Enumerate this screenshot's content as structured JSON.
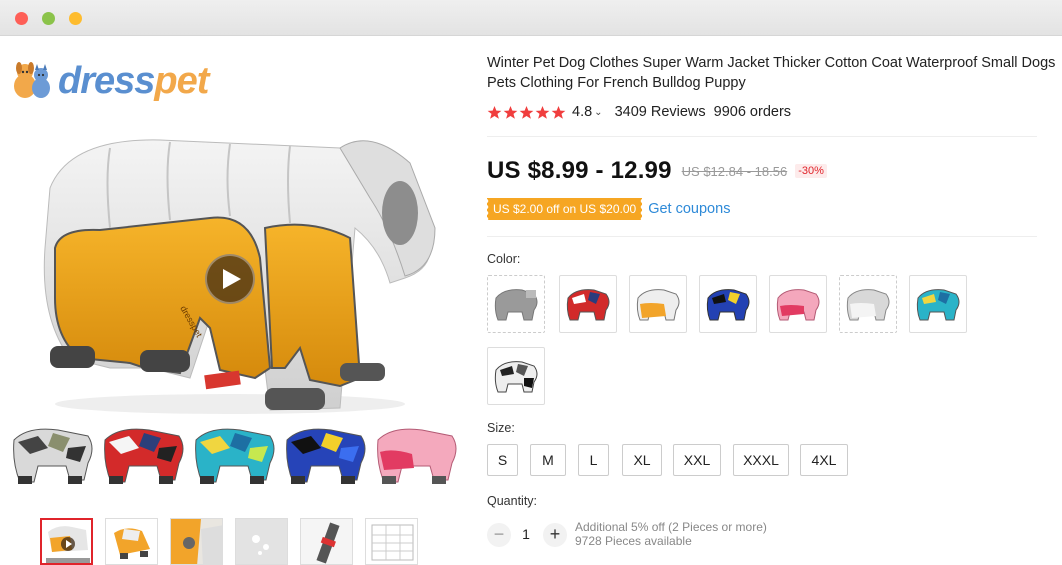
{
  "window": {
    "colors": {
      "close": "#fe5f57",
      "minimize": "#8bc34a",
      "maximize": "#febc2e"
    }
  },
  "brand": {
    "logo_part1": "dress",
    "logo_part2": "pet"
  },
  "product": {
    "title": "Winter Pet Dog Clothes Super Warm Jacket Thicker Cotton Coat Waterproof Small Dogs Pets Clothing For French Bulldog Puppy",
    "rating": "4.8",
    "stars": 5,
    "reviews": "3409 Reviews",
    "orders": "9906 orders",
    "price": "US $8.99 - 12.99",
    "old_price": "US $12.84 - 18.56",
    "discount": "-30%",
    "coupon_tag": "US $2.00 off on US $20.00",
    "coupon_link": "Get coupons",
    "accent_color": "#e0242b",
    "coupon_color": "#f6a623",
    "link_color": "#2e8ad8"
  },
  "gallery": {
    "play_icon": "play-icon",
    "strip_variants": [
      "camo-black",
      "camo-red",
      "camo-teal",
      "camo-blue",
      "pink"
    ],
    "thumbnails": [
      "thumb-video",
      "thumb-2",
      "thumb-3",
      "thumb-4",
      "thumb-5",
      "thumb-size-chart"
    ]
  },
  "color": {
    "label": "Color:",
    "options": [
      "grey",
      "red-camo",
      "orange",
      "blue-camo",
      "pink",
      "grey-light",
      "teal-camo",
      "black-white"
    ]
  },
  "size": {
    "label": "Size:",
    "options": [
      "S",
      "M",
      "L",
      "XL",
      "XXL",
      "XXXL",
      "4XL"
    ]
  },
  "quantity": {
    "label": "Quantity:",
    "value": "1",
    "minus": "−",
    "plus": "+",
    "offer": "Additional 5% off (2 Pieces or more)",
    "available": "9728 Pieces available"
  }
}
